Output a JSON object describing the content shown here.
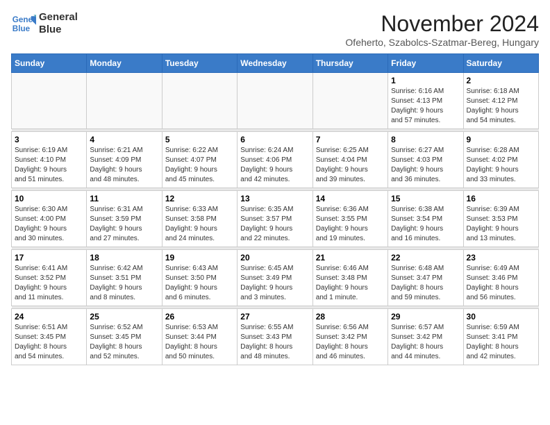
{
  "header": {
    "logo_line1": "General",
    "logo_line2": "Blue",
    "month_title": "November 2024",
    "location": "Ofeherto, Szabolcs-Szatmar-Bereg, Hungary"
  },
  "weekdays": [
    "Sunday",
    "Monday",
    "Tuesday",
    "Wednesday",
    "Thursday",
    "Friday",
    "Saturday"
  ],
  "weeks": [
    [
      {
        "day": "",
        "info": ""
      },
      {
        "day": "",
        "info": ""
      },
      {
        "day": "",
        "info": ""
      },
      {
        "day": "",
        "info": ""
      },
      {
        "day": "",
        "info": ""
      },
      {
        "day": "1",
        "info": "Sunrise: 6:16 AM\nSunset: 4:13 PM\nDaylight: 9 hours\nand 57 minutes."
      },
      {
        "day": "2",
        "info": "Sunrise: 6:18 AM\nSunset: 4:12 PM\nDaylight: 9 hours\nand 54 minutes."
      }
    ],
    [
      {
        "day": "3",
        "info": "Sunrise: 6:19 AM\nSunset: 4:10 PM\nDaylight: 9 hours\nand 51 minutes."
      },
      {
        "day": "4",
        "info": "Sunrise: 6:21 AM\nSunset: 4:09 PM\nDaylight: 9 hours\nand 48 minutes."
      },
      {
        "day": "5",
        "info": "Sunrise: 6:22 AM\nSunset: 4:07 PM\nDaylight: 9 hours\nand 45 minutes."
      },
      {
        "day": "6",
        "info": "Sunrise: 6:24 AM\nSunset: 4:06 PM\nDaylight: 9 hours\nand 42 minutes."
      },
      {
        "day": "7",
        "info": "Sunrise: 6:25 AM\nSunset: 4:04 PM\nDaylight: 9 hours\nand 39 minutes."
      },
      {
        "day": "8",
        "info": "Sunrise: 6:27 AM\nSunset: 4:03 PM\nDaylight: 9 hours\nand 36 minutes."
      },
      {
        "day": "9",
        "info": "Sunrise: 6:28 AM\nSunset: 4:02 PM\nDaylight: 9 hours\nand 33 minutes."
      }
    ],
    [
      {
        "day": "10",
        "info": "Sunrise: 6:30 AM\nSunset: 4:00 PM\nDaylight: 9 hours\nand 30 minutes."
      },
      {
        "day": "11",
        "info": "Sunrise: 6:31 AM\nSunset: 3:59 PM\nDaylight: 9 hours\nand 27 minutes."
      },
      {
        "day": "12",
        "info": "Sunrise: 6:33 AM\nSunset: 3:58 PM\nDaylight: 9 hours\nand 24 minutes."
      },
      {
        "day": "13",
        "info": "Sunrise: 6:35 AM\nSunset: 3:57 PM\nDaylight: 9 hours\nand 22 minutes."
      },
      {
        "day": "14",
        "info": "Sunrise: 6:36 AM\nSunset: 3:55 PM\nDaylight: 9 hours\nand 19 minutes."
      },
      {
        "day": "15",
        "info": "Sunrise: 6:38 AM\nSunset: 3:54 PM\nDaylight: 9 hours\nand 16 minutes."
      },
      {
        "day": "16",
        "info": "Sunrise: 6:39 AM\nSunset: 3:53 PM\nDaylight: 9 hours\nand 13 minutes."
      }
    ],
    [
      {
        "day": "17",
        "info": "Sunrise: 6:41 AM\nSunset: 3:52 PM\nDaylight: 9 hours\nand 11 minutes."
      },
      {
        "day": "18",
        "info": "Sunrise: 6:42 AM\nSunset: 3:51 PM\nDaylight: 9 hours\nand 8 minutes."
      },
      {
        "day": "19",
        "info": "Sunrise: 6:43 AM\nSunset: 3:50 PM\nDaylight: 9 hours\nand 6 minutes."
      },
      {
        "day": "20",
        "info": "Sunrise: 6:45 AM\nSunset: 3:49 PM\nDaylight: 9 hours\nand 3 minutes."
      },
      {
        "day": "21",
        "info": "Sunrise: 6:46 AM\nSunset: 3:48 PM\nDaylight: 9 hours\nand 1 minute."
      },
      {
        "day": "22",
        "info": "Sunrise: 6:48 AM\nSunset: 3:47 PM\nDaylight: 8 hours\nand 59 minutes."
      },
      {
        "day": "23",
        "info": "Sunrise: 6:49 AM\nSunset: 3:46 PM\nDaylight: 8 hours\nand 56 minutes."
      }
    ],
    [
      {
        "day": "24",
        "info": "Sunrise: 6:51 AM\nSunset: 3:45 PM\nDaylight: 8 hours\nand 54 minutes."
      },
      {
        "day": "25",
        "info": "Sunrise: 6:52 AM\nSunset: 3:45 PM\nDaylight: 8 hours\nand 52 minutes."
      },
      {
        "day": "26",
        "info": "Sunrise: 6:53 AM\nSunset: 3:44 PM\nDaylight: 8 hours\nand 50 minutes."
      },
      {
        "day": "27",
        "info": "Sunrise: 6:55 AM\nSunset: 3:43 PM\nDaylight: 8 hours\nand 48 minutes."
      },
      {
        "day": "28",
        "info": "Sunrise: 6:56 AM\nSunset: 3:42 PM\nDaylight: 8 hours\nand 46 minutes."
      },
      {
        "day": "29",
        "info": "Sunrise: 6:57 AM\nSunset: 3:42 PM\nDaylight: 8 hours\nand 44 minutes."
      },
      {
        "day": "30",
        "info": "Sunrise: 6:59 AM\nSunset: 3:41 PM\nDaylight: 8 hours\nand 42 minutes."
      }
    ]
  ]
}
